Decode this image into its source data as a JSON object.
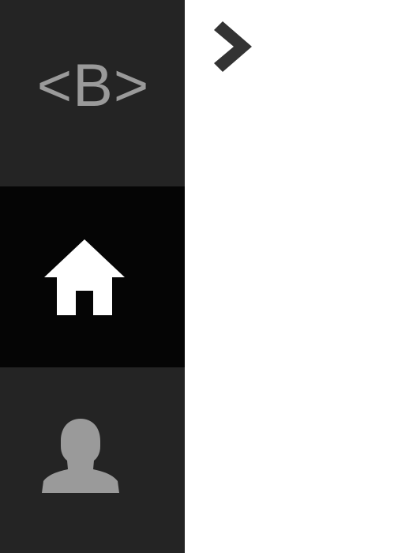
{
  "sidebar": {
    "logo": {
      "text": "<B>"
    },
    "items": [
      {
        "icon": "home-icon",
        "active": true
      },
      {
        "icon": "user-icon",
        "active": false
      }
    ]
  },
  "toolbar": {
    "toggle_icon": "chevron-right-icon"
  },
  "colors": {
    "sidebar_bg": "#242424",
    "sidebar_active_bg": "#050505",
    "logo_text": "#9a9a9a",
    "icon_active": "#ffffff",
    "icon_inactive": "#9a9a9a",
    "chevron": "#333333",
    "content_bg": "#ffffff"
  }
}
